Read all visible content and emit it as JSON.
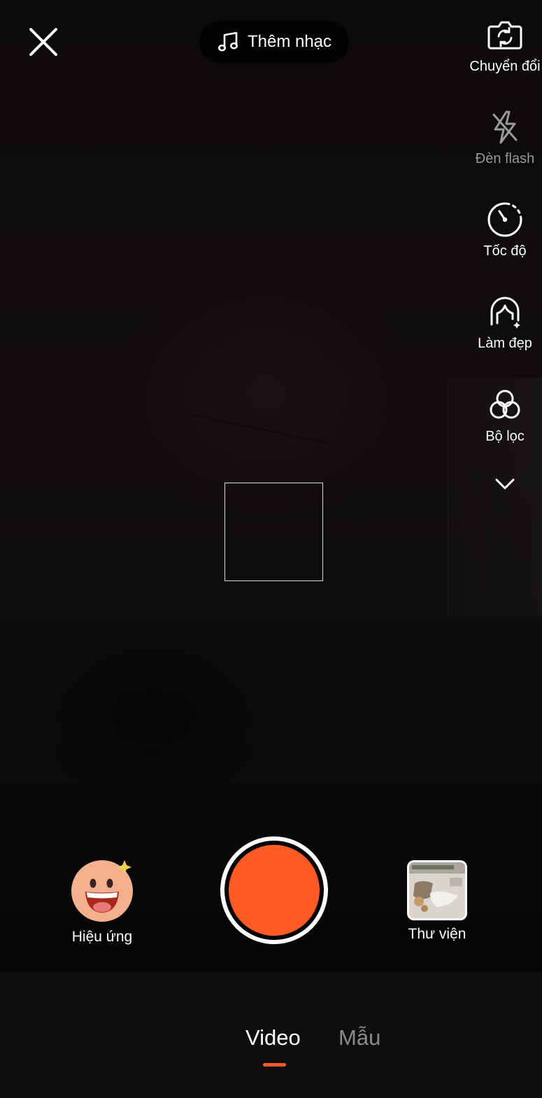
{
  "camera": {
    "add_music_label": "Thêm nhạc"
  },
  "side_tools": {
    "flip": "Chuyển đổi",
    "flash": "Đèn flash",
    "speed": "Tốc độ",
    "beauty": "Làm đẹp",
    "filters": "Bộ lọc"
  },
  "capture": {
    "effects_label": "Hiệu ứng",
    "gallery_label": "Thư viện"
  },
  "modes": {
    "video": "Video",
    "template": "Mẫu",
    "active": "Video"
  },
  "colors": {
    "accent": "#ff5a26",
    "background": "#000000",
    "bottom_bar": "#0e0e0e",
    "inactive_text": "#8b8b8b"
  },
  "icons": {
    "close": "close-icon",
    "music": "music-note-icon",
    "flip": "camera-flip-icon",
    "flash": "flash-off-icon",
    "speed": "speed-icon",
    "beauty": "beauty-face-icon",
    "filters": "filters-icon",
    "more": "chevron-down-icon",
    "effects": "effects-smiley-icon"
  }
}
